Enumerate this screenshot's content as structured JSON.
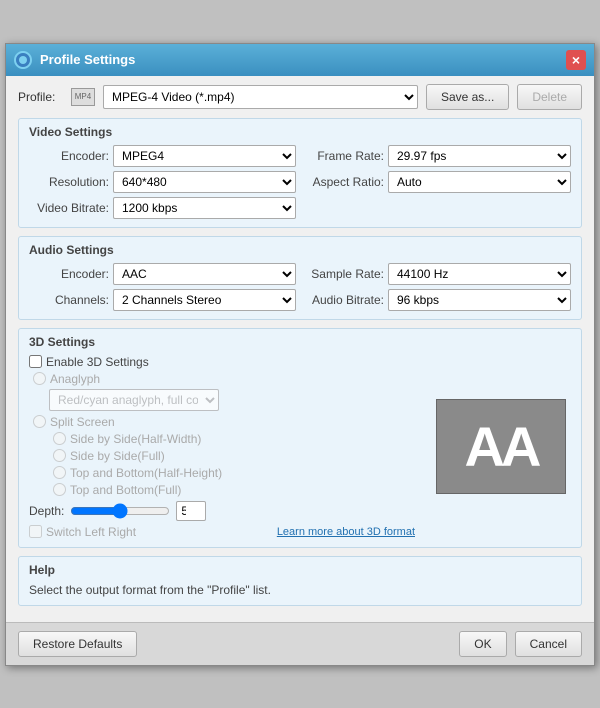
{
  "window": {
    "title": "Profile Settings",
    "close_icon": "×"
  },
  "profile_row": {
    "label": "Profile:",
    "value": "MPEG-4 Video (*.mp4)",
    "save_as_label": "Save as...",
    "delete_label": "Delete"
  },
  "video_settings": {
    "title": "Video Settings",
    "encoder_label": "Encoder:",
    "encoder_value": "MPEG4",
    "resolution_label": "Resolution:",
    "resolution_value": "640*480",
    "video_bitrate_label": "Video Bitrate:",
    "video_bitrate_value": "1200 kbps",
    "frame_rate_label": "Frame Rate:",
    "frame_rate_value": "29.97 fps",
    "aspect_ratio_label": "Aspect Ratio:",
    "aspect_ratio_value": "Auto"
  },
  "audio_settings": {
    "title": "Audio Settings",
    "encoder_label": "Encoder:",
    "encoder_value": "AAC",
    "channels_label": "Channels:",
    "channels_value": "2 Channels Stereo",
    "sample_rate_label": "Sample Rate:",
    "sample_rate_value": "44100 Hz",
    "audio_bitrate_label": "Audio Bitrate:",
    "audio_bitrate_value": "96 kbps"
  },
  "settings_3d": {
    "title": "3D Settings",
    "enable_label": "Enable 3D Settings",
    "anaglyph_label": "Anaglyph",
    "anaglyph_value": "Red/cyan anaglyph, full color",
    "split_screen_label": "Split Screen",
    "split_options": [
      "Side by Side(Half-Width)",
      "Side by Side(Full)",
      "Top and Bottom(Half-Height)",
      "Top and Bottom(Full)"
    ],
    "depth_label": "Depth:",
    "depth_value": "5",
    "switch_label": "Switch Left Right",
    "learn_more": "Learn more about 3D format",
    "aa_text": "AA"
  },
  "help": {
    "title": "Help",
    "text": "Select the output format from the \"Profile\" list."
  },
  "footer": {
    "restore_label": "Restore Defaults",
    "ok_label": "OK",
    "cancel_label": "Cancel"
  }
}
